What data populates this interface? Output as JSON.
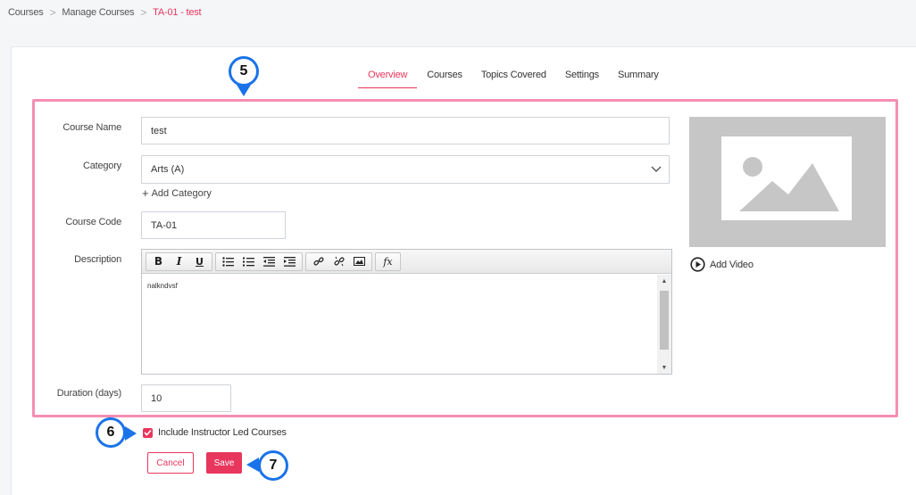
{
  "breadcrumb": {
    "items": [
      "Courses",
      "Manage Courses",
      "TA-01 - test"
    ]
  },
  "tabs": [
    "Overview",
    "Courses",
    "Topics Covered",
    "Settings",
    "Summary"
  ],
  "form": {
    "course_name_label": "Course Name",
    "course_name_value": "test",
    "category_label": "Category",
    "category_value": "Arts (A)",
    "add_category": "Add Category",
    "course_code_label": "Course Code",
    "course_code_value": "TA-01",
    "description_label": "Description",
    "description_value": "nalkndvsf",
    "duration_label": "Duration (days)",
    "duration_value": "10"
  },
  "media": {
    "add_video": "Add Video"
  },
  "options": {
    "include_ilc_label": "Include Instructor Led Courses",
    "include_ilc_checked": true
  },
  "actions": {
    "cancel": "Cancel",
    "save": "Save"
  },
  "callouts": {
    "c5": "5",
    "c6": "6",
    "c7": "7"
  },
  "colors": {
    "accent": "#e8365d",
    "highlight": "#f48fb1",
    "callout": "#1a73e8"
  }
}
